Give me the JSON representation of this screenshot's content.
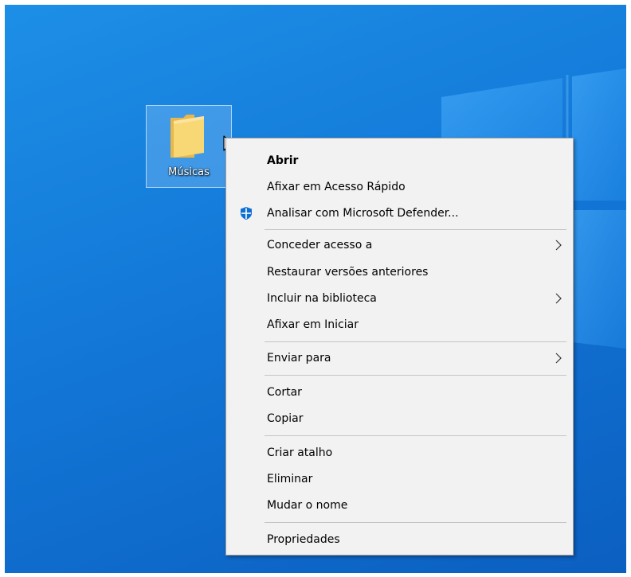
{
  "desktop": {
    "icon_label": "Músicas",
    "icon_name": "folder-icon"
  },
  "context_menu": {
    "items": [
      {
        "label": "Abrir",
        "bold": true
      },
      {
        "label": "Afixar em Acesso Rápido"
      },
      {
        "label": "Analisar com Microsoft Defender...",
        "icon": "defender-shield-icon"
      },
      {
        "label": "Conceder acesso a",
        "submenu": true
      },
      {
        "label": "Restaurar versões anteriores"
      },
      {
        "label": "Incluir na biblioteca",
        "submenu": true
      },
      {
        "label": "Afixar em Iniciar"
      },
      {
        "label": "Enviar para",
        "submenu": true
      },
      {
        "label": "Cortar"
      },
      {
        "label": "Copiar"
      },
      {
        "label": "Criar atalho"
      },
      {
        "label": "Eliminar"
      },
      {
        "label": "Mudar o nome"
      },
      {
        "label": "Propriedades"
      }
    ]
  },
  "colors": {
    "desktop_blue": "#1378d8",
    "menu_background": "#f2f2f2",
    "defender_blue": "#0b6fd3",
    "folder_yellow": "#f8d775"
  }
}
